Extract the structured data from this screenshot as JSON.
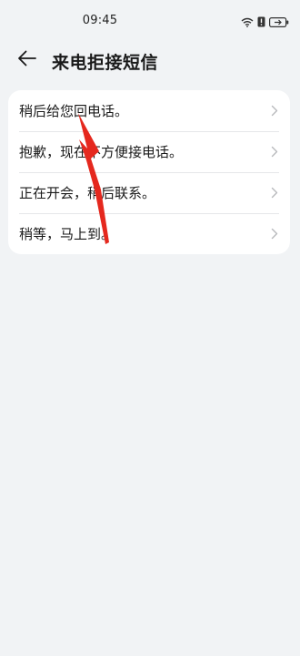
{
  "status_bar": {
    "time": "09:45",
    "icons": [
      "wifi-icon",
      "notification-icon",
      "battery-icon"
    ]
  },
  "header": {
    "back_icon": "arrow-left-icon",
    "title": "来电拒接短信"
  },
  "messages": [
    {
      "label": "稍后给您回电话。"
    },
    {
      "label": "抱歉，现在不方便接电话。"
    },
    {
      "label": "正在开会，稍后联系。"
    },
    {
      "label": "稍等，马上到。"
    }
  ],
  "colors": {
    "background": "#f1f3f5",
    "card": "#ffffff",
    "annotation_arrow": "#e5281e"
  }
}
